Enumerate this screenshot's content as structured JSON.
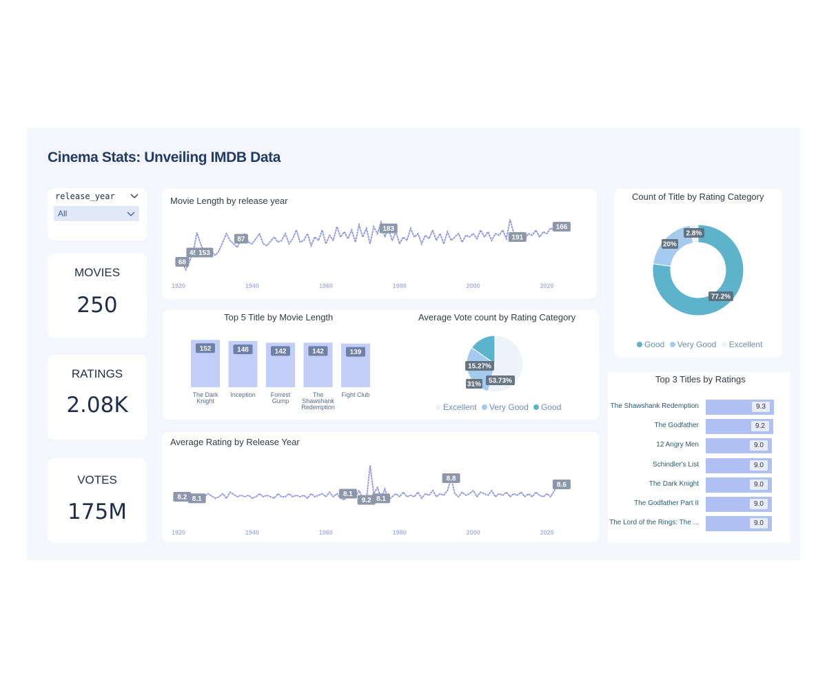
{
  "title": "Cinema Stats: Unveiling IMDB Data",
  "slicer": {
    "field": "release_year",
    "value": "All"
  },
  "kpis": {
    "movies": {
      "label": "MOVIES",
      "value": "250"
    },
    "ratings": {
      "label": "RATINGS",
      "value": "2.08K"
    },
    "votes": {
      "label": "VOTES",
      "value": "175M"
    }
  },
  "colors": {
    "line": "#8e99e6",
    "bar": "#c2cef7",
    "good": "#5eb3cc",
    "very_good": "#a4cbee",
    "excellent": "#eef2fa",
    "hbar": "#b0c0f2"
  },
  "chart_data": [
    {
      "type": "line",
      "title": "Movie Length by release year",
      "xlabel": "",
      "ylabel": "",
      "xticks": [
        "1920",
        "1940",
        "1960",
        "1980",
        "2000",
        "2020"
      ],
      "xlim": [
        1920,
        2024
      ],
      "ylim": [
        40,
        200
      ],
      "x": [
        1921,
        1922,
        1924,
        1925,
        1926,
        1927,
        1928,
        1930,
        1931,
        1932,
        1933,
        1934,
        1936,
        1937,
        1938,
        1939,
        1940,
        1941,
        1942,
        1943,
        1944,
        1946,
        1947,
        1948,
        1949,
        1950,
        1951,
        1952,
        1953,
        1954,
        1955,
        1956,
        1957,
        1958,
        1959,
        1960,
        1961,
        1962,
        1963,
        1964,
        1965,
        1966,
        1967,
        1968,
        1969,
        1970,
        1971,
        1972,
        1973,
        1974,
        1975,
        1976,
        1977,
        1978,
        1979,
        1980,
        1981,
        1982,
        1983,
        1984,
        1985,
        1986,
        1987,
        1988,
        1989,
        1990,
        1991,
        1992,
        1993,
        1994,
        1995,
        1996,
        1997,
        1998,
        1999,
        2000,
        2001,
        2002,
        2003,
        2004,
        2005,
        2006,
        2007,
        2008,
        2009,
        2010,
        2011,
        2012,
        2013,
        2014,
        2015,
        2016,
        2017,
        2018,
        2019,
        2020,
        2021,
        2022,
        2023
      ],
      "values": [
        68,
        45,
        95,
        153,
        120,
        95,
        105,
        87,
        100,
        125,
        150,
        130,
        110,
        135,
        150,
        125,
        120,
        135,
        150,
        120,
        115,
        140,
        125,
        130,
        150,
        120,
        135,
        160,
        125,
        130,
        150,
        115,
        140,
        130,
        160,
        120,
        145,
        130,
        170,
        140,
        155,
        135,
        160,
        125,
        175,
        140,
        165,
        120,
        170,
        150,
        183,
        140,
        165,
        130,
        155,
        120,
        140,
        130,
        165,
        140,
        150,
        120,
        145,
        135,
        160,
        130,
        150,
        120,
        155,
        130,
        140,
        150,
        125,
        145,
        140,
        150,
        135,
        160,
        140,
        155,
        130,
        150,
        145,
        160,
        135,
        191,
        150,
        140,
        155,
        135,
        150,
        145,
        160,
        140,
        155,
        150,
        166,
        160,
        170
      ],
      "labels": [
        {
          "x": 1921,
          "text": "68"
        },
        {
          "x": 1924,
          "text": "45"
        },
        {
          "x": 1927,
          "text": "153"
        },
        {
          "x": 1937,
          "text": "87"
        },
        {
          "x": 1977,
          "text": "183"
        },
        {
          "x": 2012,
          "text": "191"
        },
        {
          "x": 2024,
          "text": "166"
        }
      ]
    },
    {
      "type": "bar",
      "title": "Top 5 Title by Movie Length",
      "categories": [
        "The Dark Knight",
        "Inception",
        "Forrest Gump",
        "The Shawshank Redemption",
        "Fight Club"
      ],
      "category_lines": [
        [
          "The Dark",
          "Knight"
        ],
        [
          "Inception"
        ],
        [
          "Forrest",
          "Gump"
        ],
        [
          "The",
          "Shawshank",
          "Redemption"
        ],
        [
          "Fight Club"
        ]
      ],
      "values": [
        152,
        148,
        142,
        142,
        139
      ],
      "ylim": [
        0,
        160
      ],
      "xlabel": "",
      "ylabel": ""
    },
    {
      "type": "pie",
      "title": "Average Vote count by Rating Category",
      "categories": [
        "Excellent",
        "Very Good",
        "Good"
      ],
      "values": [
        53.73,
        31,
        15.27
      ],
      "labels": [
        "53.73%",
        "31%",
        "15.27%"
      ],
      "legend": "bottom"
    },
    {
      "type": "line",
      "title": "Average Rating by Release Year",
      "xlabel": "",
      "ylabel": "",
      "xticks": [
        "1920",
        "1940",
        "1960",
        "1980",
        "2000",
        "2020"
      ],
      "xlim": [
        1920,
        2024
      ],
      "ylim": [
        7.8,
        9.4
      ],
      "x": [
        1921,
        1922,
        1923,
        1924,
        1925,
        1926,
        1928,
        1930,
        1931,
        1932,
        1933,
        1934,
        1936,
        1937,
        1938,
        1939,
        1940,
        1941,
        1942,
        1943,
        1944,
        1946,
        1947,
        1948,
        1949,
        1950,
        1951,
        1952,
        1953,
        1954,
        1955,
        1956,
        1957,
        1958,
        1959,
        1960,
        1961,
        1962,
        1963,
        1964,
        1965,
        1966,
        1967,
        1968,
        1969,
        1970,
        1971,
        1972,
        1973,
        1974,
        1975,
        1976,
        1977,
        1978,
        1979,
        1980,
        1981,
        1982,
        1983,
        1984,
        1985,
        1986,
        1987,
        1988,
        1989,
        1990,
        1991,
        1992,
        1993,
        1994,
        1995,
        1996,
        1997,
        1998,
        1999,
        2000,
        2001,
        2002,
        2003,
        2004,
        2005,
        2006,
        2007,
        2008,
        2009,
        2010,
        2011,
        2012,
        2013,
        2014,
        2015,
        2016,
        2017,
        2018,
        2019,
        2020,
        2021,
        2022,
        2023
      ],
      "values": [
        8.2,
        8.15,
        8.2,
        8.1,
        8.15,
        8.1,
        8.3,
        8.15,
        8.2,
        8.3,
        8.15,
        8.35,
        8.2,
        8.25,
        8.2,
        8.25,
        8.15,
        8.2,
        8.3,
        8.2,
        8.25,
        8.15,
        8.3,
        8.2,
        8.2,
        8.3,
        8.2,
        8.25,
        8.2,
        8.25,
        8.15,
        8.3,
        8.2,
        8.25,
        8.3,
        8.2,
        8.35,
        8.2,
        8.3,
        8.15,
        8.1,
        8.3,
        8.35,
        8.2,
        8.4,
        8.15,
        8.1,
        9.2,
        8.3,
        8.5,
        8.15,
        8.45,
        8.1,
        8.2,
        8.3,
        8.2,
        8.35,
        8.2,
        8.25,
        8.2,
        8.35,
        8.15,
        8.3,
        8.25,
        8.4,
        8.2,
        8.3,
        8.25,
        8.4,
        8.8,
        8.3,
        8.2,
        8.35,
        8.25,
        8.3,
        8.4,
        8.2,
        8.35,
        8.3,
        8.25,
        8.4,
        8.2,
        8.3,
        8.25,
        8.35,
        8.2,
        8.3,
        8.25,
        8.35,
        8.2,
        8.3,
        8.2,
        8.35,
        8.25,
        8.2,
        8.3,
        8.2,
        8.4,
        8.6
      ],
      "labels": [
        {
          "x": 1921,
          "text": "8.2"
        },
        {
          "x": 1925,
          "text": "8.1"
        },
        {
          "x": 1966,
          "text": "8.1"
        },
        {
          "x": 1971,
          "text": "9.2"
        },
        {
          "x": 1975,
          "text": "8.1"
        },
        {
          "x": 1994,
          "text": "8.8"
        },
        {
          "x": 2024,
          "text": "8.6"
        }
      ]
    },
    {
      "type": "pie",
      "title": "Count of Title by Rating Category",
      "categories": [
        "Good",
        "Very Good",
        "Excellent"
      ],
      "values": [
        77.2,
        20,
        2.8
      ],
      "labels": [
        "77.2%",
        "20%",
        "2.8%"
      ],
      "legend": "bottom"
    },
    {
      "type": "bar",
      "title": "Top 3 Titles by Ratings",
      "orientation": "horizontal",
      "categories": [
        "The Shawshank Redemption",
        "The Godfather",
        "12 Angry Men",
        "Schindler's List",
        "The Dark Knight",
        "The Godfather Part II",
        "The Lord of the Rings: The ..."
      ],
      "values": [
        9.3,
        9.2,
        9.0,
        9.0,
        9.0,
        9.0,
        9.0
      ],
      "labels": [
        "9.3",
        "9.2",
        "9.0",
        "9.0",
        "9.0",
        "9.0",
        "9.0"
      ]
    }
  ]
}
